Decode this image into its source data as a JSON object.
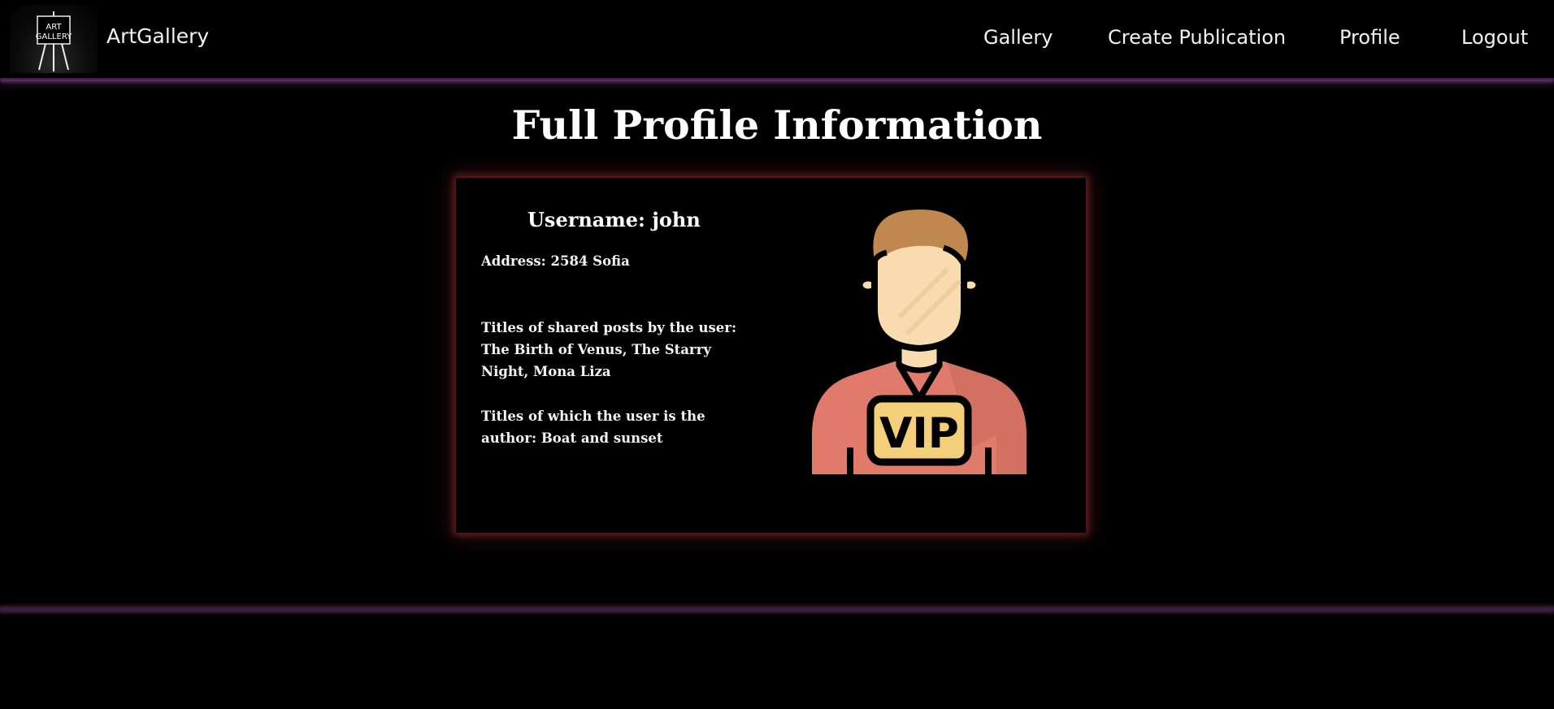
{
  "navbar": {
    "logo": {
      "line1": "ART",
      "line2": "GALLERY"
    },
    "brand": "ArtGallery",
    "links": [
      "Gallery",
      "Create Publication",
      "Profile",
      "Logout"
    ]
  },
  "page": {
    "title": "Full Profile Information"
  },
  "profile": {
    "username": "Username: john",
    "address": "Address: 2584 Sofia",
    "shared_posts": "Titles of shared posts by the user: The Birth of Venus, The Starry Night, Mona Liza",
    "authored": "Titles of which the user is the author: Boat and sunset",
    "avatar_badge": "VIP",
    "avatar_icon": "vip-user-avatar-icon"
  },
  "colors": {
    "background": "#000000",
    "nav_glow": "#7a4282",
    "card_glow": "#a03232",
    "avatar_shirt": "#e07a6a",
    "avatar_hair": "#c0874f",
    "avatar_skin": "#f8dcb0",
    "avatar_badge": "#f4cf7a"
  }
}
